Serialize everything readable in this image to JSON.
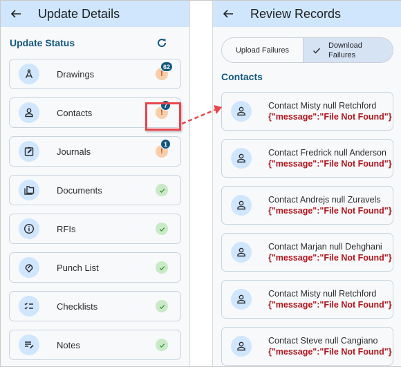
{
  "left": {
    "title": "Update Details",
    "back_icon": "arrow-left-icon",
    "section_title": "Update Status",
    "refresh_icon": "refresh-icon",
    "items": [
      {
        "label": "Drawings",
        "icon": "compass-icon",
        "status": "warning",
        "count": "62"
      },
      {
        "label": "Contacts",
        "icon": "person-icon",
        "status": "warning",
        "count": "7"
      },
      {
        "label": "Journals",
        "icon": "clipboard-edit-icon",
        "status": "warning",
        "count": "1"
      },
      {
        "label": "Documents",
        "icon": "folders-icon",
        "status": "success",
        "count": null
      },
      {
        "label": "RFIs",
        "icon": "info-icon",
        "status": "success",
        "count": null
      },
      {
        "label": "Punch List",
        "icon": "punch-pin-icon",
        "status": "success",
        "count": null
      },
      {
        "label": "Checklists",
        "icon": "checklist-icon",
        "status": "success",
        "count": null
      },
      {
        "label": "Notes",
        "icon": "notes-edit-icon",
        "status": "success",
        "count": null
      }
    ],
    "warning_glyph": "!",
    "colors": {
      "warning_bg": "#f8cfaa",
      "success_bg": "#c9e9c7",
      "badge_bg": "#12577f",
      "highlight": "#e8454d"
    }
  },
  "right": {
    "title": "Review Records",
    "back_icon": "arrow-left-icon",
    "segmented": {
      "upload_label": "Upload Failures",
      "download_label_1": "Download",
      "download_label_2": "Failures",
      "selected": "Download Failures"
    },
    "section_title": "Contacts",
    "records": [
      {
        "name": "Contact Misty null Retchford",
        "error": "{\"message\":\"File Not Found\"}"
      },
      {
        "name": "Contact Fredrick null Anderson",
        "error": "{\"message\":\"File Not Found\"}"
      },
      {
        "name": "Contact Andrejs null Zuravels",
        "error": "{\"message\":\"File Not Found\"}"
      },
      {
        "name": "Contact Marjan null Dehghani",
        "error": "{\"message\":\"File Not Found\"}"
      },
      {
        "name": "Contact Misty null Retchford",
        "error": "{\"message\":\"File Not Found\"}"
      },
      {
        "name": "Contact Steve null Cangiano",
        "error": "{\"message\":\"File Not Found\"}"
      }
    ]
  }
}
